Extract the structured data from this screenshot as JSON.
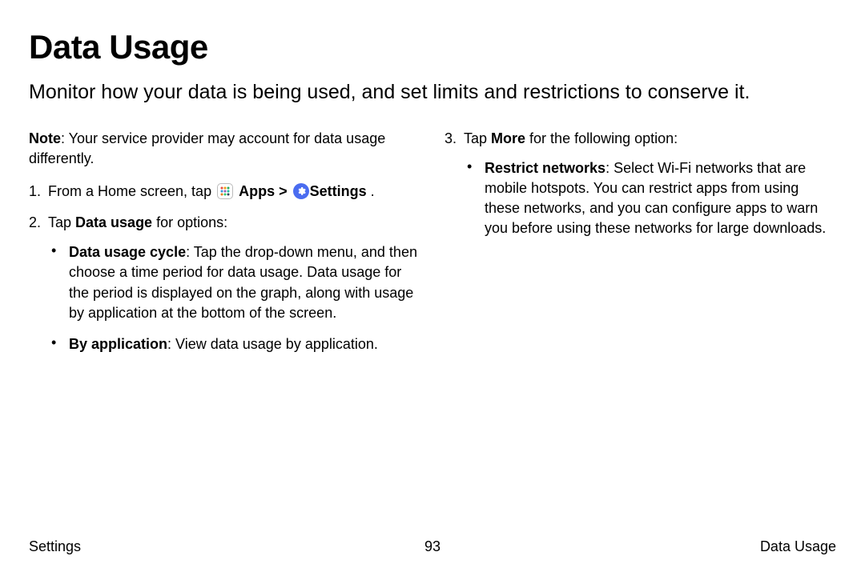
{
  "title": "Data Usage",
  "subtitle": "Monitor how your data is being used, and set limits and restrictions to conserve it.",
  "note": {
    "label": "Note",
    "text": ": Your service provider may account for data usage differently."
  },
  "step1": {
    "num": "1.",
    "pre": "From a Home screen, tap ",
    "apps_label": "Apps",
    "sep": " > ",
    "settings_label": "Settings",
    "post": " ."
  },
  "step2": {
    "num": "2.",
    "pre": "Tap ",
    "bold": "Data usage",
    "post": " for options:",
    "bullet1": {
      "bold": "Data usage cycle",
      "text": ": Tap the drop-down menu, and then choose a time period for data usage. Data usage for the period is displayed on the graph, along with usage by application at the bottom of the screen."
    },
    "bullet2": {
      "bold": "By application",
      "text": ": View data usage by application."
    }
  },
  "step3": {
    "num": "3.",
    "pre": "Tap ",
    "bold": "More",
    "post": " for the following option:",
    "bullet1": {
      "bold": "Restrict networks",
      "text": ": Select Wi-Fi networks that are mobile hotspots. You can restrict apps from using these networks, and you can configure apps to warn you before using these networks for large downloads."
    }
  },
  "footer": {
    "left": "Settings",
    "center": "93",
    "right": "Data Usage"
  }
}
